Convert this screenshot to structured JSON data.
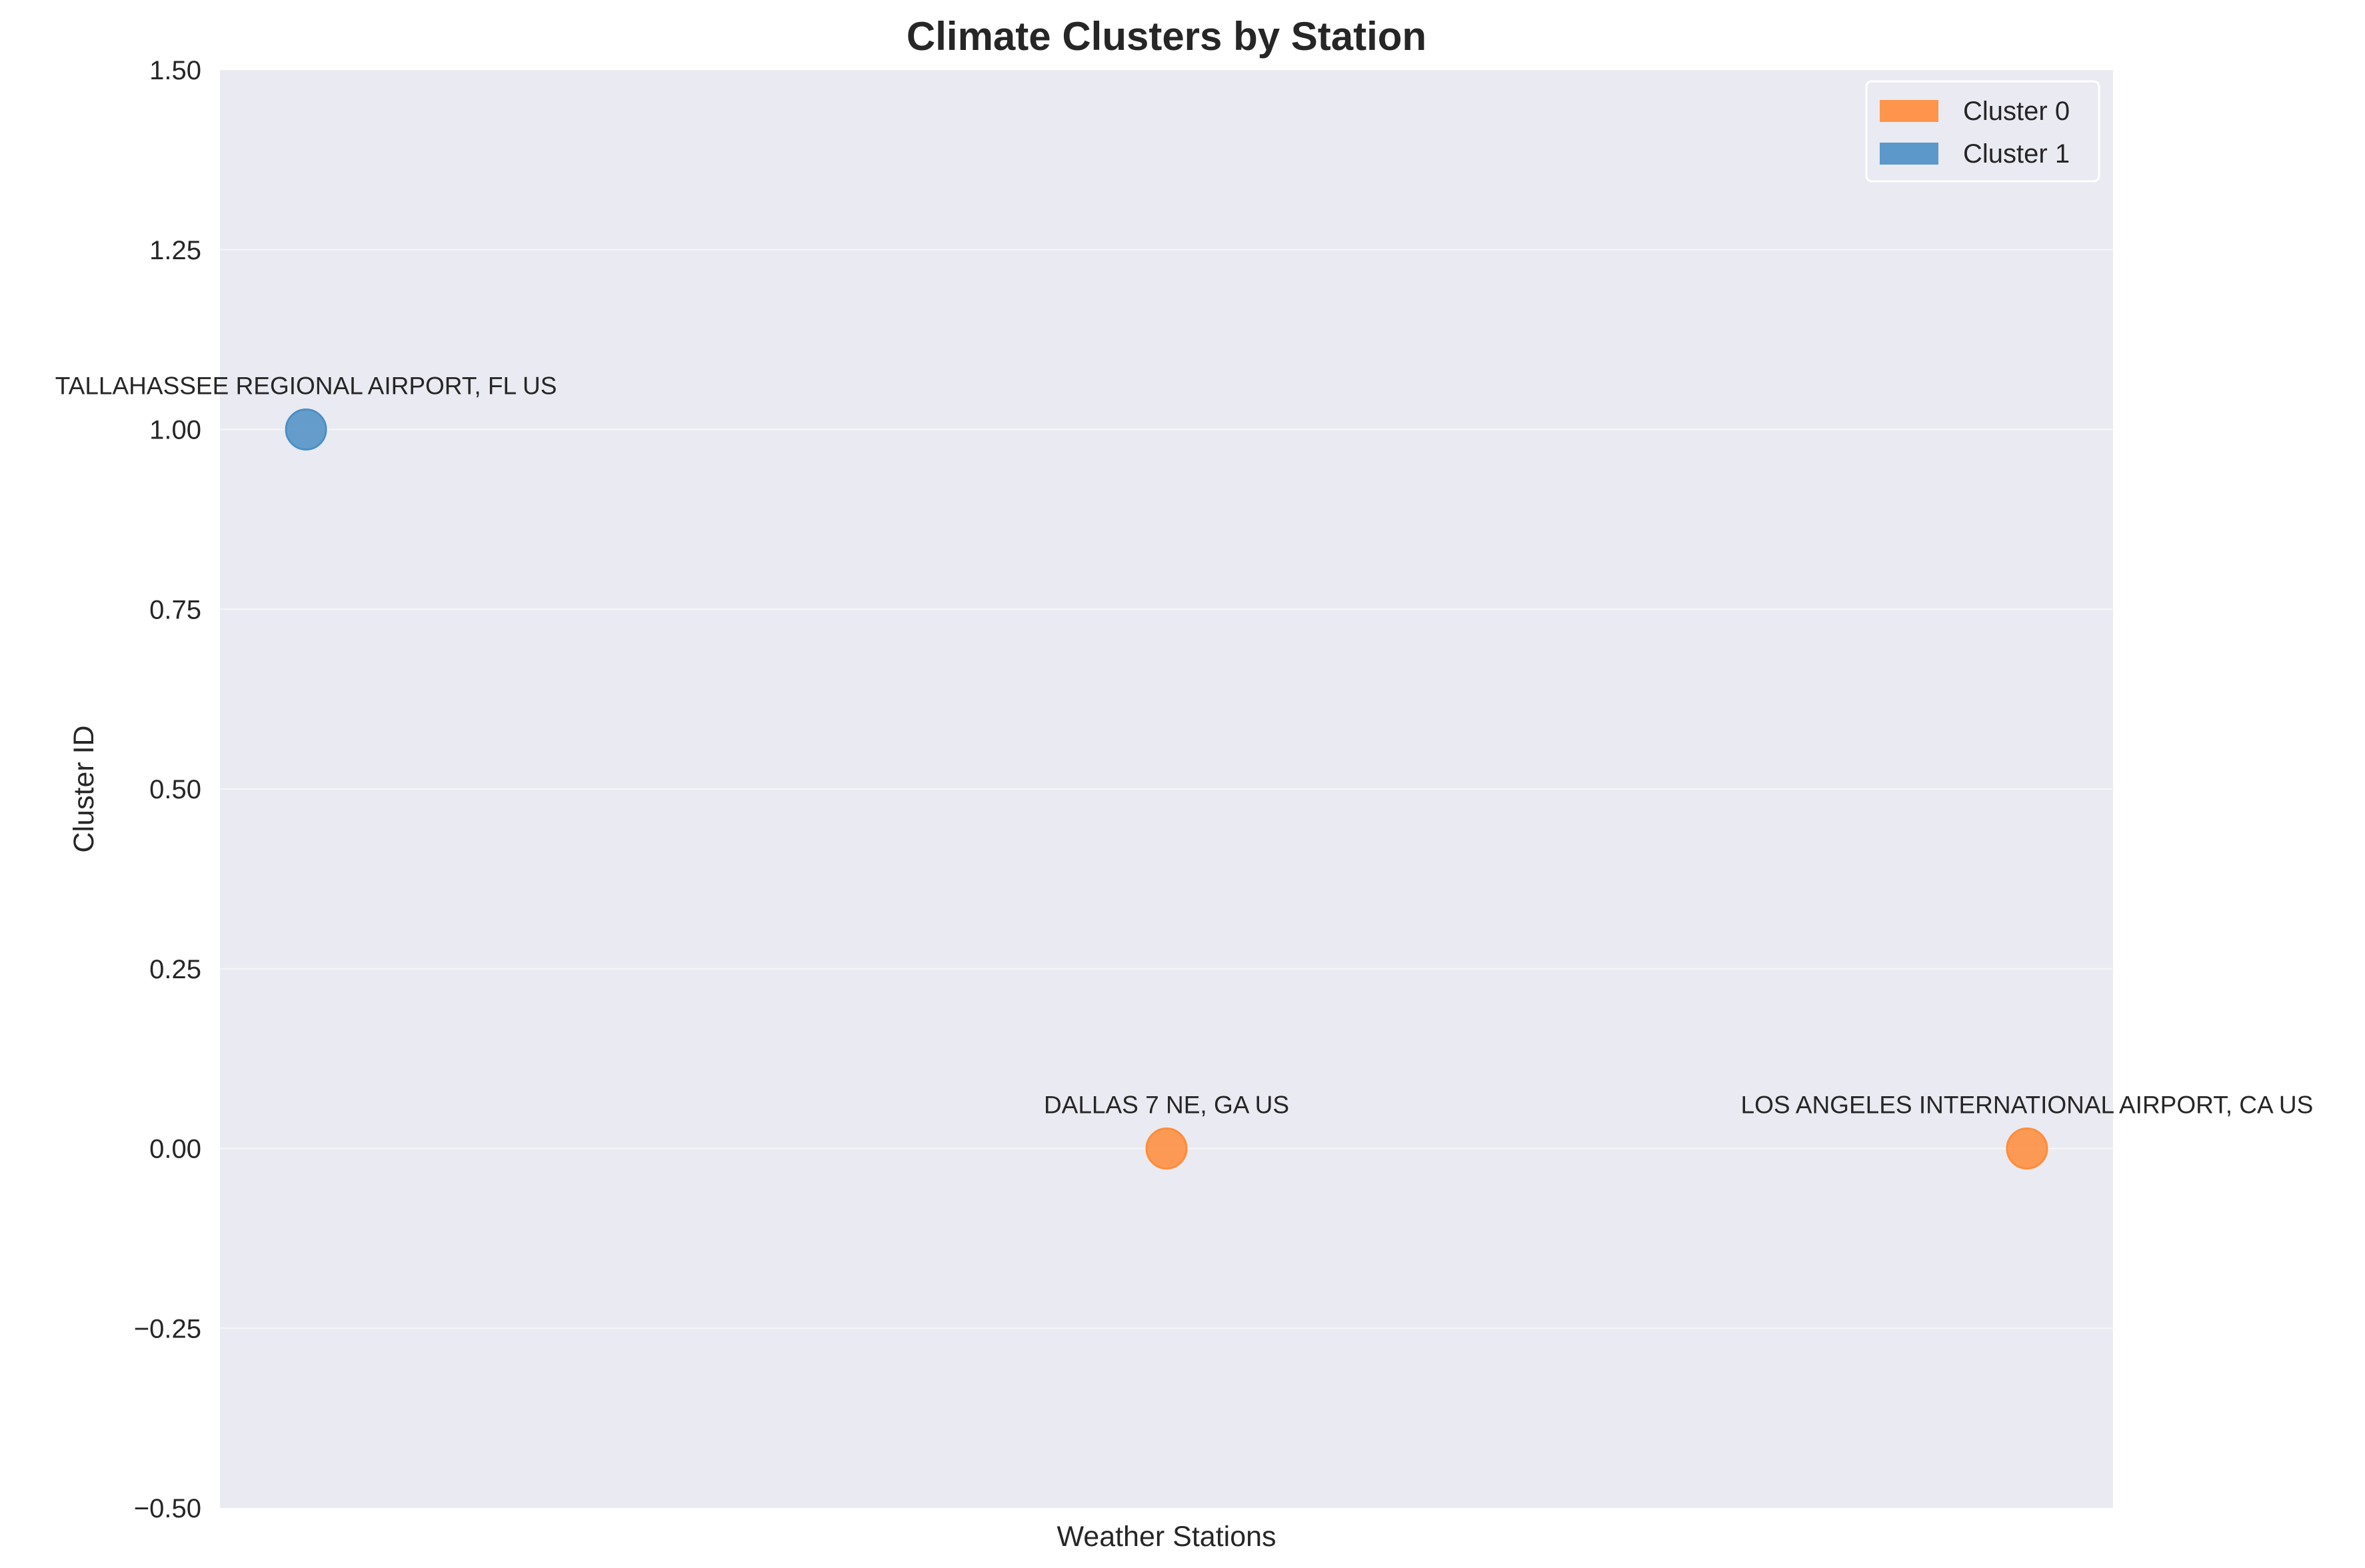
{
  "chart_data": {
    "type": "scatter",
    "title": "Climate Clusters by Station",
    "xlabel": "Weather Stations",
    "ylabel": "Cluster ID",
    "ylim": [
      -0.5,
      1.5
    ],
    "yticks": [
      -0.5,
      -0.25,
      0.0,
      0.25,
      0.5,
      0.75,
      1.0,
      1.25,
      1.5
    ],
    "ytick_labels": [
      "−0.50",
      "−0.25",
      "0.00",
      "0.25",
      "0.50",
      "0.75",
      "1.00",
      "1.25",
      "1.50"
    ],
    "x_ticks_shown": false,
    "grid": "y",
    "legend_position": "top-right",
    "series": [
      {
        "name": "Cluster 0",
        "color": "#ff8c3a"
      },
      {
        "name": "Cluster 1",
        "color": "#4c8fc4"
      }
    ],
    "points": [
      {
        "x": 0,
        "y": 1,
        "cluster": 1,
        "label": "TALLAHASSEE REGIONAL AIRPORT, FL US"
      },
      {
        "x": 1,
        "y": 0,
        "cluster": 0,
        "label": "DALLAS 7 NE, GA US"
      },
      {
        "x": 2,
        "y": 0,
        "cluster": 0,
        "label": "LOS ANGELES INTERNATIONAL AIRPORT, CA US"
      }
    ]
  },
  "colors": {
    "plot_background": "#eaeaf2",
    "grid": "#ffffff",
    "text": "#262626"
  }
}
